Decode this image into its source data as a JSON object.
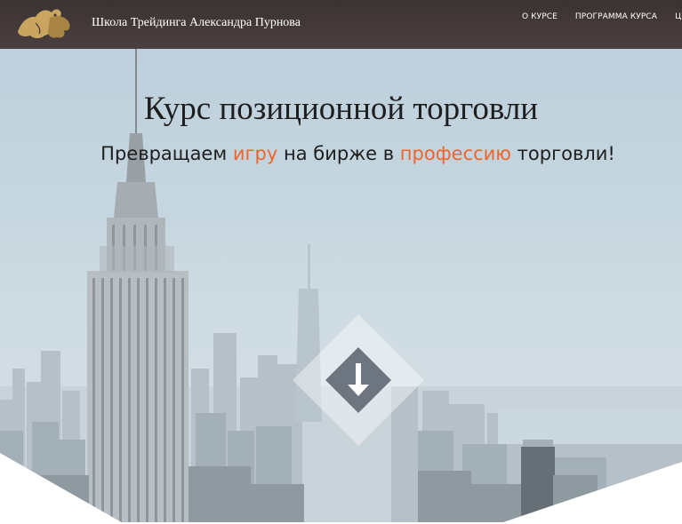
{
  "header": {
    "brand": "Школа Трейдинга Александра Пурнова",
    "logo_icon": "bull-bear-logo-icon",
    "nav": [
      "О КУРСЕ",
      "ПРОГРАММА КУРСА",
      "ЦЕ"
    ]
  },
  "hero": {
    "title": "Курс позиционной торговли",
    "subtitle_parts": [
      "Превращаем ",
      "игру",
      " на бирже в ",
      "профессию",
      " торговли!"
    ],
    "scroll_icon": "arrow-down-icon"
  },
  "colors": {
    "header_bg": "#3b3232",
    "accent": "#f0642a",
    "text": "#1e1e1e",
    "logo_gold": "#c9a560"
  }
}
